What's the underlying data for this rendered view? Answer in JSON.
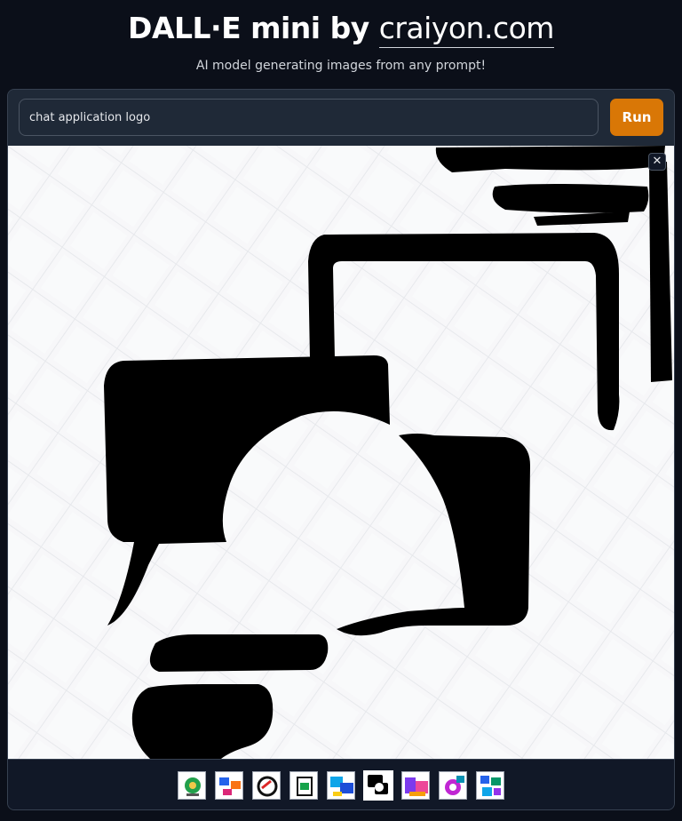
{
  "header": {
    "title_prefix": "DALL·E mini by ",
    "title_link": "craiyon.com",
    "subtitle": "AI model generating images from any prompt!"
  },
  "prompt": {
    "value": "chat application logo",
    "placeholder": ""
  },
  "run_button": {
    "label": "Run"
  },
  "gallery": {
    "close_label": "✕",
    "selected_index": 5,
    "thumbnail_count": 9
  },
  "colors": {
    "background": "#0b0f19",
    "panel": "#1f2937",
    "run_button": "#d97706",
    "image_background": "#f3f4f6",
    "logo_ink": "#000000"
  }
}
